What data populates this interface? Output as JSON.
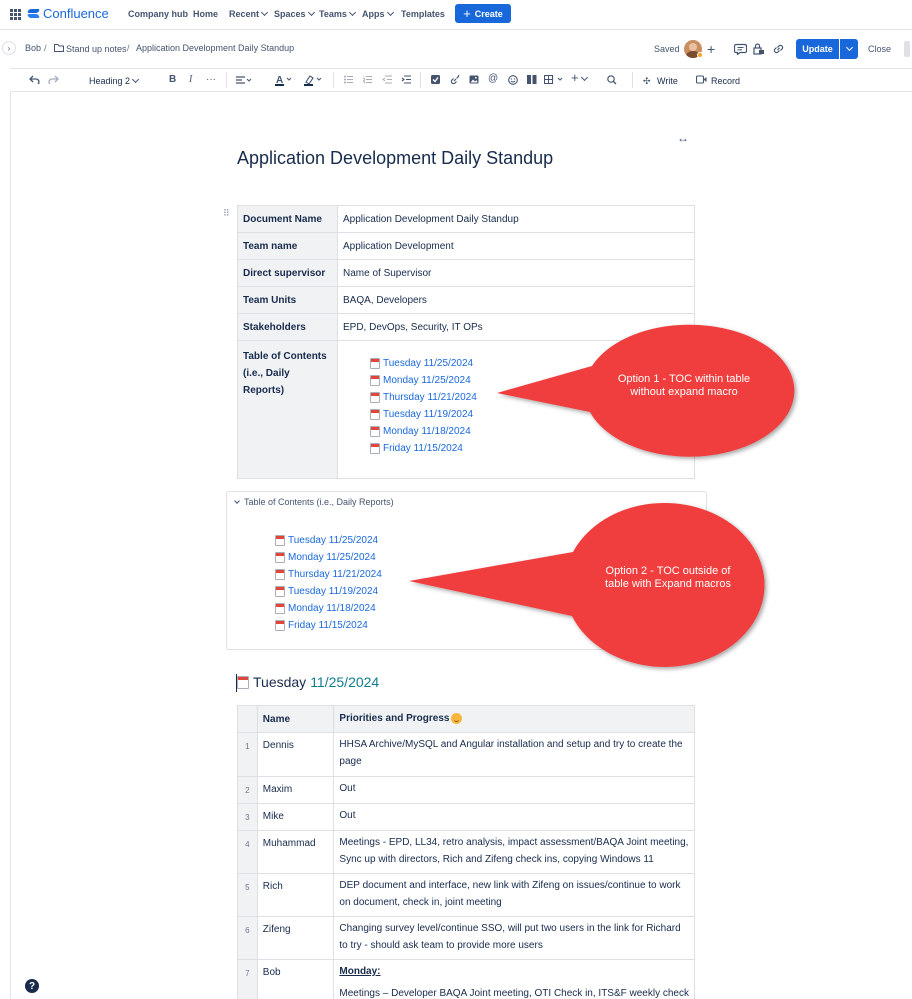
{
  "topnav": {
    "brand": "Confluence",
    "items": [
      "Company hub",
      "Home",
      "Recent",
      "Spaces",
      "Teams",
      "Apps",
      "Templates"
    ],
    "create_label": "Create"
  },
  "breadcrumb": {
    "items": [
      "Bob",
      "Stand up notes",
      "Application Development Daily Standup"
    ],
    "saved_label": "Saved",
    "update_label": "Update",
    "close_label": "Close"
  },
  "toolbar": {
    "text_style": "Heading 2",
    "write_label": "Write",
    "record_label": "Record"
  },
  "page": {
    "title": "Application Development Daily Standup",
    "info_table": [
      {
        "key": "Document Name",
        "value": "Application Development Daily Standup"
      },
      {
        "key": "Team name",
        "value": "Application Development"
      },
      {
        "key": "Direct supervisor",
        "value": "Name of Supervisor"
      },
      {
        "key": "Team Units",
        "value": "BAQA, Developers"
      },
      {
        "key": "Stakeholders",
        "value": "EPD, DevOps, Security, IT OPs"
      }
    ],
    "toc_key_line1": "Table of Contents",
    "toc_key_line2": "(i.e., Daily Reports)",
    "toc_items": [
      "Tuesday 11/25/2024",
      "Monday 11/25/2024",
      "Thursday 11/21/2024",
      "Tuesday 11/19/2024",
      "Monday 11/18/2024",
      "Friday 11/15/2024"
    ],
    "expand_title": "Table of Contents (i.e., Daily Reports)",
    "callout1_line1": "Option 1 - TOC within table",
    "callout1_line2": "without expand macro",
    "callout2_line1": "Option 2 - TOC outside of",
    "callout2_line2": "table with Expand macros",
    "heading_day": "Tuesday",
    "heading_date": "11/25/2024",
    "standup_headers": [
      "Name",
      "Priorities and Progress"
    ],
    "standup_rows": [
      {
        "num": "1",
        "name": "Dennis",
        "progress": "HHSA Archive/MySQL and Angular installation and setup and try to create the page"
      },
      {
        "num": "2",
        "name": "Maxim",
        "progress": "Out"
      },
      {
        "num": "3",
        "name": "Mike",
        "progress": "Out"
      },
      {
        "num": "4",
        "name": "Muhammad",
        "progress": "Meetings - EPD, LL34, retro analysis, impact assessment/BAQA Joint meeting, Sync up with directors, Rich and Zifeng check ins, copying Windows 11"
      },
      {
        "num": "5",
        "name": "Rich",
        "progress": "DEP document and interface, new link with Zifeng on issues/continue to work on document, check in, joint meeting"
      },
      {
        "num": "6",
        "name": "Zifeng",
        "progress": "Changing survey level/continue SSO, will put two users in the link for Richard to try - should ask team to provide more users"
      },
      {
        "num": "7",
        "name": "Bob",
        "progress": "Monday:",
        "progress_more": "Meetings – Developer BAQA Joint meeting, OTI Check in, ITS&F weekly check"
      }
    ]
  },
  "colors": {
    "accent": "#1868db",
    "callout": "#f03e3e",
    "heading_date": "#0f7c8f"
  }
}
